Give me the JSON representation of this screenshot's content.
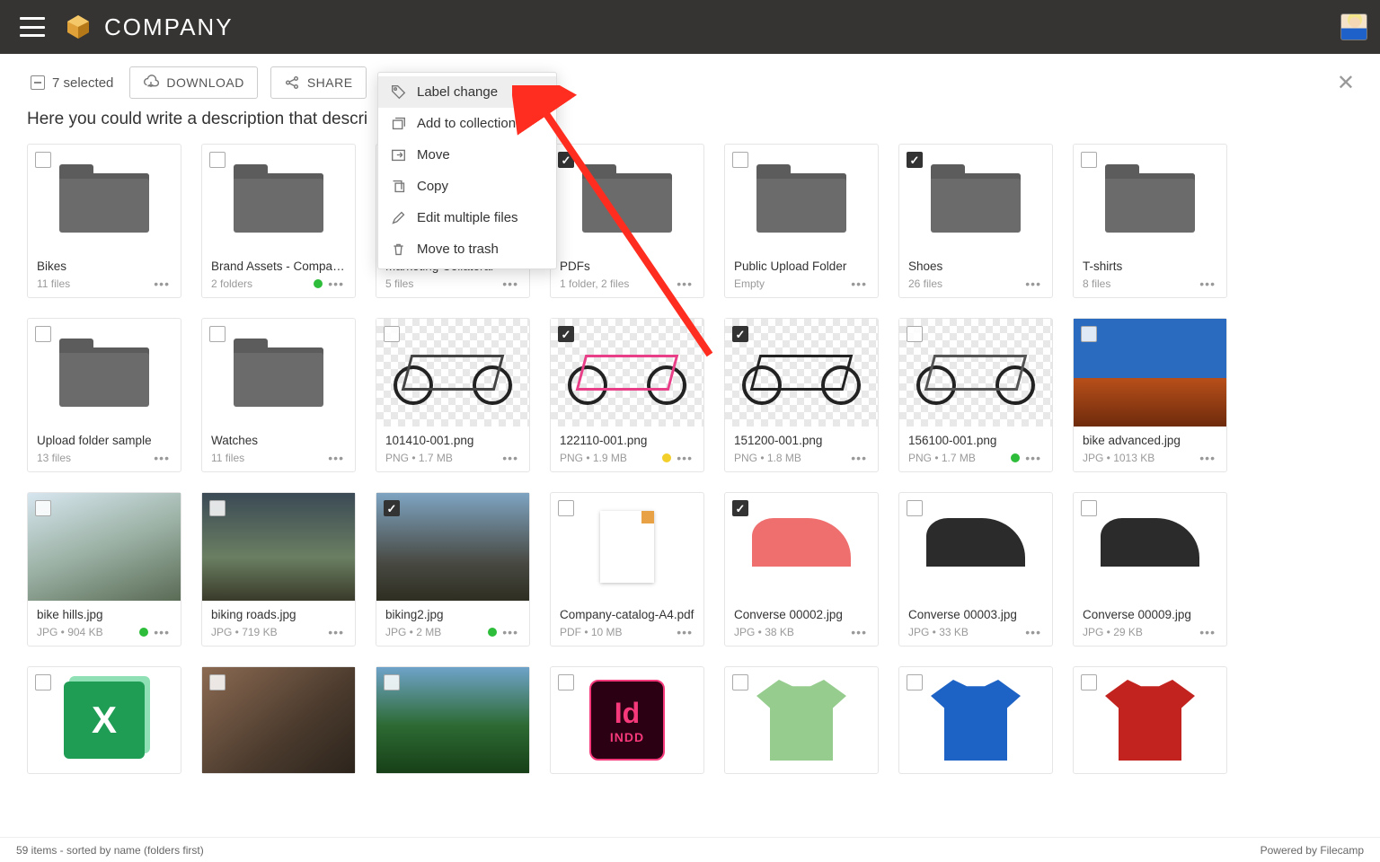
{
  "header": {
    "brand": "COMPANY"
  },
  "toolbar": {
    "selected_label": "7 selected",
    "download_label": "DOWNLOAD",
    "share_label": "SHARE"
  },
  "description": "Here you could write a description that descri",
  "context_menu": {
    "items": [
      {
        "label": "Label change"
      },
      {
        "label": "Add to collection"
      },
      {
        "label": "Move"
      },
      {
        "label": "Copy"
      },
      {
        "label": "Edit multiple files"
      },
      {
        "label": "Move to trash"
      }
    ]
  },
  "colors": {
    "dot_green": "#2dbd3a",
    "dot_yellow": "#f3cf2b",
    "arrow_red": "#ff2d20"
  },
  "footer": {
    "left": "59 items - sorted by name (folders first)",
    "right": "Powered by Filecamp"
  },
  "cards": [
    {
      "kind": "folder",
      "title": "Bikes",
      "sub": "11 files",
      "checked": false,
      "dot": null
    },
    {
      "kind": "folder",
      "title": "Brand Assets - Company Inc.",
      "sub": "2 folders",
      "checked": false,
      "dot": "green"
    },
    {
      "kind": "folder",
      "title": "Marketing Collateral",
      "sub": "5 files",
      "checked": false,
      "dot": null
    },
    {
      "kind": "folder",
      "title": "PDFs",
      "sub": "1 folder, 2 files",
      "checked": true,
      "dot": null
    },
    {
      "kind": "folder",
      "title": "Public Upload Folder",
      "sub": "Empty",
      "checked": false,
      "dot": null
    },
    {
      "kind": "folder",
      "title": "Shoes",
      "sub": "26 files",
      "checked": true,
      "dot": null
    },
    {
      "kind": "folder",
      "title": "T-shirts",
      "sub": "8 files",
      "checked": false,
      "dot": null
    },
    {
      "kind": "folder",
      "title": "Upload folder sample",
      "sub": "13 files",
      "checked": false,
      "dot": null
    },
    {
      "kind": "folder",
      "title": "Watches",
      "sub": "11 files",
      "checked": false,
      "dot": null
    },
    {
      "kind": "bike",
      "title": "101410-001.png",
      "sub": "PNG • 1.7 MB",
      "checked": false,
      "dot": null,
      "fc": "#444"
    },
    {
      "kind": "bike",
      "title": "122110-001.png",
      "sub": "PNG • 1.9 MB",
      "checked": true,
      "dot": "yellow",
      "fc": "#e83f88"
    },
    {
      "kind": "bike",
      "title": "151200-001.png",
      "sub": "PNG • 1.8 MB",
      "checked": true,
      "dot": null,
      "fc": "#222"
    },
    {
      "kind": "bike",
      "title": "156100-001.png",
      "sub": "PNG • 1.7 MB",
      "checked": false,
      "dot": "green",
      "fc": "#555"
    },
    {
      "kind": "photo",
      "title": "bike advanced.jpg",
      "sub": "JPG • 1013 KB",
      "checked": false,
      "dot": null,
      "bg": "linear-gradient(180deg,#2a6abf 0%,#2a6abf 55%,#b84f1a 55%,#6e2b0c 100%)"
    },
    {
      "kind": "photo",
      "title": "bike hills.jpg",
      "sub": "JPG • 904 KB",
      "checked": false,
      "dot": "green",
      "bg": "linear-gradient(160deg,#d7e6ef 0%,#9bb1a4 50%,#5a6b55 100%)"
    },
    {
      "kind": "photo",
      "title": "biking roads.jpg",
      "sub": "JPG • 719 KB",
      "checked": false,
      "dot": null,
      "bg": "linear-gradient(180deg,#3b4a55 0%,#6a7f62 60%,#3a3a2a 100%)"
    },
    {
      "kind": "photo",
      "title": "biking2.jpg",
      "sub": "JPG • 2 MB",
      "checked": true,
      "dot": "green",
      "bg": "linear-gradient(180deg,#7ea4c2 0%,#484942 65%,#2e2e22 100%)"
    },
    {
      "kind": "pdf",
      "title": "Company-catalog-A4.pdf",
      "sub": "PDF • 10 MB",
      "checked": false,
      "dot": null
    },
    {
      "kind": "shoe",
      "title": "Converse 00002.jpg",
      "sub": "JPG • 38 KB",
      "checked": true,
      "dot": null,
      "sc": "#ef6e6e"
    },
    {
      "kind": "shoe",
      "title": "Converse 00003.jpg",
      "sub": "JPG • 33 KB",
      "checked": false,
      "dot": null,
      "sc": "#2b2b2b",
      "accent": "#e3c13a"
    },
    {
      "kind": "shoe",
      "title": "Converse 00009.jpg",
      "sub": "JPG • 29 KB",
      "checked": false,
      "dot": null,
      "sc": "#2b2b2b"
    },
    {
      "kind": "excel",
      "title": "",
      "sub": "",
      "checked": false,
      "dot": null
    },
    {
      "kind": "photo",
      "title": "",
      "sub": "",
      "checked": false,
      "dot": null,
      "bg": "linear-gradient(140deg,#8b6a52 0%,#4a3a2d 60%,#2c241c 100%)"
    },
    {
      "kind": "photo",
      "title": "",
      "sub": "",
      "checked": false,
      "dot": null,
      "bg": "linear-gradient(180deg,#6fa3c9 0%,#2d6a33 55%,#174018 100%)"
    },
    {
      "kind": "indd",
      "title": "",
      "sub": "",
      "checked": false,
      "dot": null
    },
    {
      "kind": "tee",
      "title": "",
      "sub": "",
      "checked": false,
      "dot": null,
      "tc": "#96cd8f"
    },
    {
      "kind": "tee",
      "title": "",
      "sub": "",
      "checked": false,
      "dot": null,
      "tc": "#1d62c5"
    },
    {
      "kind": "tee",
      "title": "",
      "sub": "",
      "checked": false,
      "dot": null,
      "tc": "#c2231f"
    }
  ]
}
